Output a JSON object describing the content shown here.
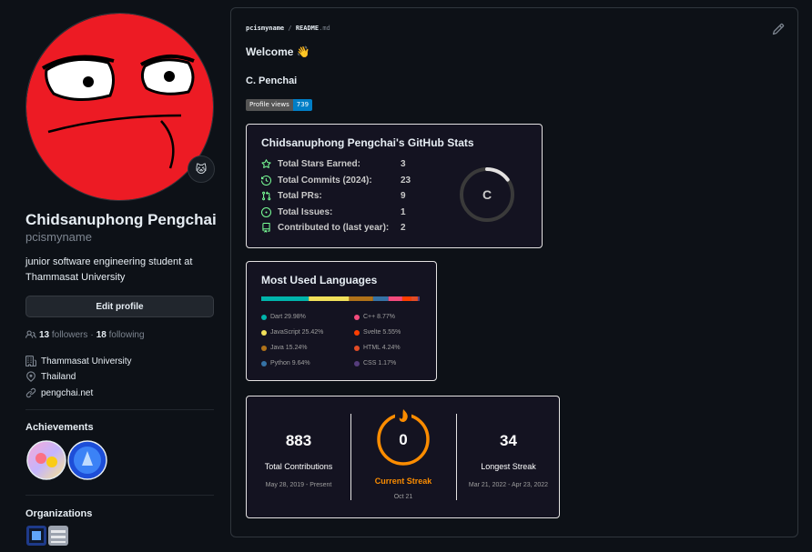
{
  "profile": {
    "full_name": "Chidsanuphong Pengchai",
    "username": "pcismyname",
    "bio": "junior software engineering student at Thammasat University",
    "edit_label": "Edit profile",
    "followers_count": "13",
    "followers_label": "followers",
    "dot": "·",
    "following_count": "18",
    "following_label": "following",
    "organization": "Thammasat University",
    "location": "Thailand",
    "website": "pengchai.net",
    "status_emoji": "🐱"
  },
  "achievements": {
    "title": "Achievements",
    "badges": [
      "yolo",
      "pull-shark"
    ]
  },
  "organizations": {
    "title": "Organizations"
  },
  "readme": {
    "path_user": "pcismyname",
    "path_sep": "/",
    "path_file": "README",
    "path_ext": ".md",
    "welcome": "Welcome 👋",
    "name": "C. Penchai",
    "views_label": "Profile views",
    "views_count": "739"
  },
  "stats_card": {
    "title": "Chidsanuphong Pengchai's GitHub Stats",
    "rows": [
      {
        "icon": "star-icon",
        "label": "Total Stars Earned:",
        "value": "3"
      },
      {
        "icon": "clock-icon",
        "label": "Total Commits (2024):",
        "value": "23"
      },
      {
        "icon": "pull-request-icon",
        "label": "Total PRs:",
        "value": "9"
      },
      {
        "icon": "issue-icon",
        "label": "Total Issues:",
        "value": "1"
      },
      {
        "icon": "repo-icon",
        "label": "Contributed to (last year):",
        "value": "2"
      }
    ],
    "rank": "C",
    "rank_progress": 0.15
  },
  "languages_card": {
    "title": "Most Used Languages",
    "languages": [
      {
        "name": "Dart",
        "percent": "29.98%",
        "value": 29.98,
        "color": "#00B4AB"
      },
      {
        "name": "JavaScript",
        "percent": "25.42%",
        "value": 25.42,
        "color": "#f1e05a"
      },
      {
        "name": "Java",
        "percent": "15.24%",
        "value": 15.24,
        "color": "#b07219"
      },
      {
        "name": "Python",
        "percent": "9.64%",
        "value": 9.64,
        "color": "#3572A5"
      },
      {
        "name": "C++",
        "percent": "8.77%",
        "value": 8.77,
        "color": "#f34b7d"
      },
      {
        "name": "Svelte",
        "percent": "5.55%",
        "value": 5.55,
        "color": "#ff3e00"
      },
      {
        "name": "HTML",
        "percent": "4.24%",
        "value": 4.24,
        "color": "#e34c26"
      },
      {
        "name": "CSS",
        "percent": "1.17%",
        "value": 1.17,
        "color": "#563d7c"
      }
    ]
  },
  "streak_card": {
    "total": {
      "value": "883",
      "label": "Total Contributions",
      "date": "May 28, 2019 - Present"
    },
    "current": {
      "value": "0",
      "label": "Current Streak",
      "date": "Oct 21"
    },
    "longest": {
      "value": "34",
      "label": "Longest Streak",
      "date": "Mar 21, 2022 - Apr 23, 2022"
    },
    "accent": "#FB8C00"
  }
}
